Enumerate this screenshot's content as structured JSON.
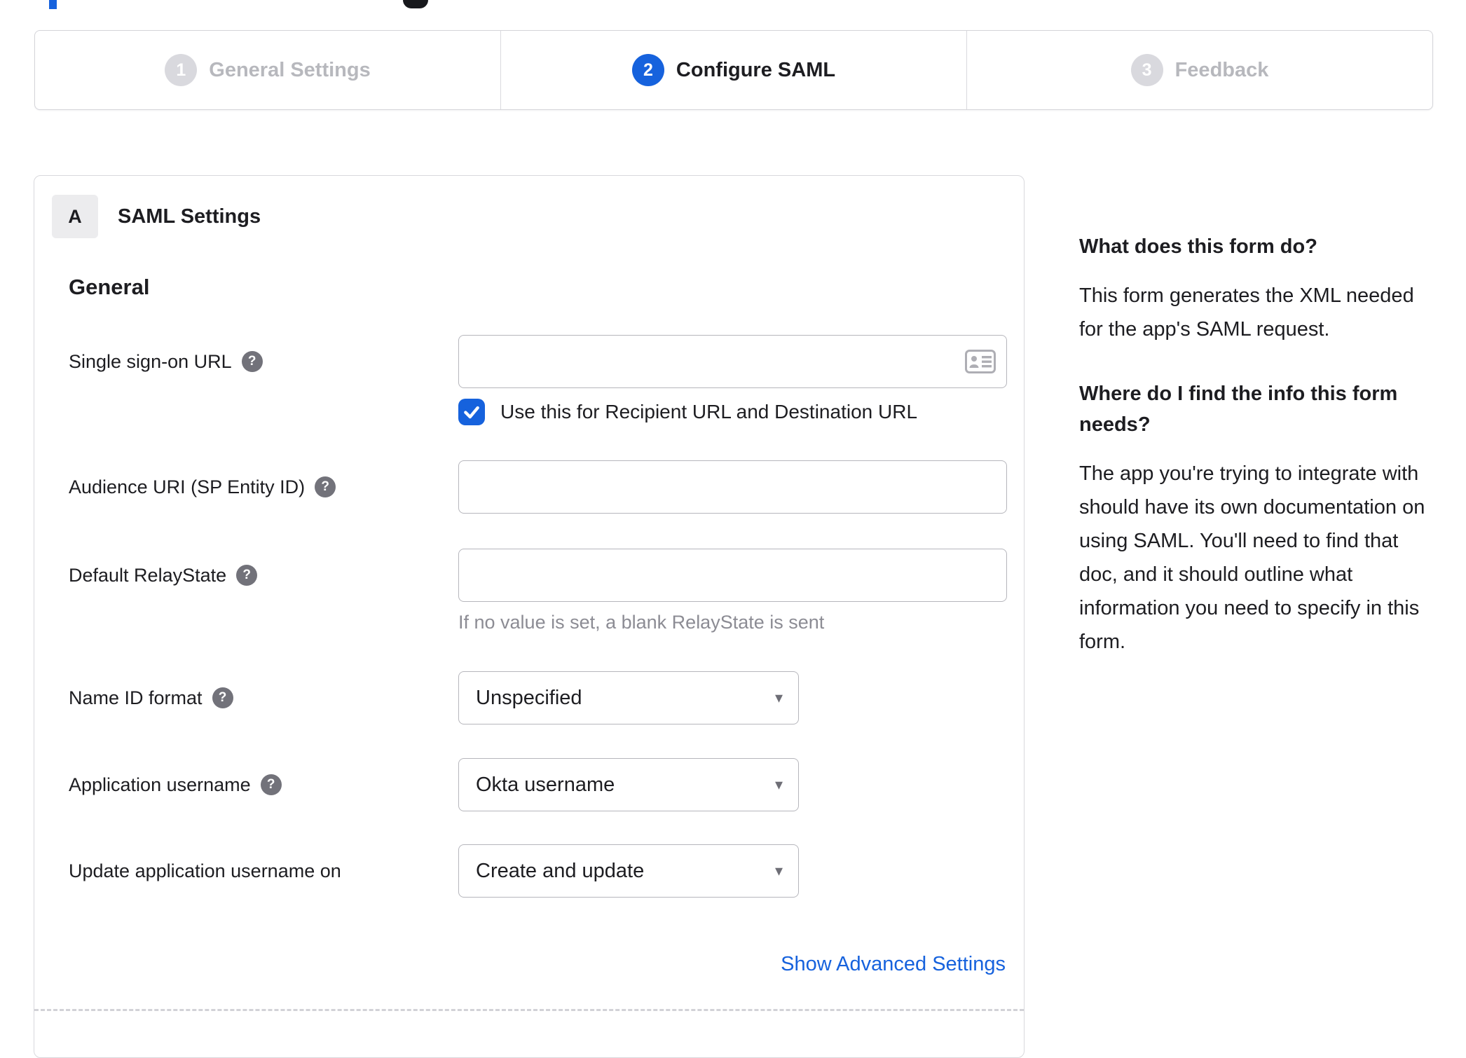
{
  "colors": {
    "accent": "#1662dd",
    "text": "#1d1d21",
    "inactive_gray": "#d9d9de",
    "border_gray": "#d8d8dc"
  },
  "icons": {
    "help": "?",
    "caret_down": "▾"
  },
  "stepper": {
    "steps": [
      {
        "number": "1",
        "label": "General Settings",
        "state": "inactive"
      },
      {
        "number": "2",
        "label": "Configure SAML",
        "state": "active"
      },
      {
        "number": "3",
        "label": "Feedback",
        "state": "inactive"
      }
    ]
  },
  "panel": {
    "badge": "A",
    "title": "SAML Settings",
    "section_title": "General",
    "fields": {
      "sso_url": {
        "label": "Single sign-on URL",
        "value": "",
        "checkbox_label": "Use this for Recipient URL and Destination URL",
        "checked": true
      },
      "audience_uri": {
        "label": "Audience URI (SP Entity ID)",
        "value": ""
      },
      "relay_state": {
        "label": "Default RelayState",
        "value": "",
        "hint": "If no value is set, a blank RelayState is sent"
      },
      "name_id_format": {
        "label": "Name ID format",
        "value": "Unspecified"
      },
      "app_username": {
        "label": "Application username",
        "value": "Okta username"
      },
      "update_username": {
        "label": "Update application username on",
        "value": "Create and update"
      }
    },
    "advanced_link": "Show Advanced Settings"
  },
  "sidebar": {
    "heading1": "What does this form do?",
    "para1": "This form generates the XML needed for the app's SAML request.",
    "heading2": "Where do I find the info this form needs?",
    "para2": "The app you're trying to integrate with should have its own documentation on using SAML. You'll need to find that doc, and it should outline what information you need to specify in this form."
  }
}
